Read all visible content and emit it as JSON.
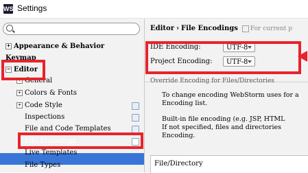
{
  "window": {
    "title": "Settings",
    "app_icon_glyph": "WS"
  },
  "search": {
    "value": "",
    "placeholder": ""
  },
  "sidebar": {
    "items": [
      {
        "label": "Appearance & Behavior",
        "expander": "⊞"
      },
      {
        "label": "Keymap"
      },
      {
        "label": "Editor",
        "expander": "⊟"
      },
      {
        "label": "General",
        "expander": "⊞"
      },
      {
        "label": "Colors & Fonts",
        "expander": "⊞"
      },
      {
        "label": "Code Style",
        "expander": "⊞"
      },
      {
        "label": "Inspections"
      },
      {
        "label": "File and Code Templates"
      },
      {
        "label": "File Encodings"
      },
      {
        "label": "Live Templates"
      },
      {
        "label": "File Types"
      }
    ],
    "selected_index": 8
  },
  "main": {
    "breadcrumb": [
      "Editor",
      "File Encodings"
    ],
    "breadcrumb_sep": "›",
    "scope_note": "For current p",
    "ide_encoding": {
      "label": "IDE Encoding:",
      "value": "UTF-8"
    },
    "project_encoding": {
      "label": "Project Encoding:",
      "value": "UTF-8"
    },
    "section_title": "Override Encoding for Files/Directories",
    "desc1_line1": "To change encoding WebStorm uses for a",
    "desc1_line2": "Encoding list.",
    "desc2_line1": "Built-in file encoding (e.g. JSP, HTML",
    "desc2_line2": "If not specified, files and directories",
    "desc2_line3": "Encoding.",
    "table_header": "File/Directory"
  },
  "colors": {
    "selection": "#3875d7",
    "annotation": "#e8232a"
  }
}
